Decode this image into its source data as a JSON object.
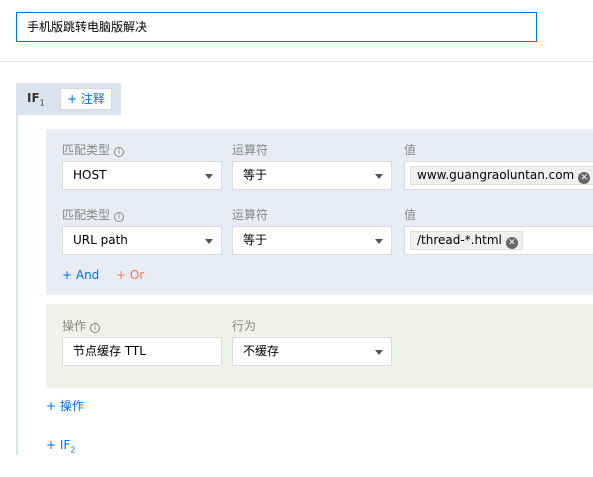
{
  "rule_name": {
    "value": "手机版跳转电脑版解决"
  },
  "if_block": {
    "label": "IF",
    "index": "1",
    "note_button": "+ 注释"
  },
  "conditions": {
    "headers": {
      "match_type": "匹配类型",
      "operator": "运算符",
      "value": "值"
    },
    "rows": [
      {
        "match_type": "HOST",
        "operator": "等于",
        "value_tag": "www.guangraoluntan.com"
      },
      {
        "match_type": "URL path",
        "operator": "等于",
        "value_tag": "/thread-*.html"
      }
    ],
    "add_and": "+ And",
    "add_or": "+ Or"
  },
  "action": {
    "headers": {
      "action": "操作",
      "behavior": "行为"
    },
    "action_value": "节点缓存 TTL",
    "behavior_value": "不缓存"
  },
  "add_action": "+ 操作",
  "add_if": {
    "label": "+ IF",
    "index": "2"
  },
  "icons": {
    "info": "info-icon",
    "remove": "close-circle-icon",
    "dropdown": "caret-down-icon"
  },
  "colors": {
    "accent": "#006eff",
    "or_link": "#ff7846",
    "condition_bg": "#e8edf5",
    "action_bg": "#eef2ea"
  }
}
